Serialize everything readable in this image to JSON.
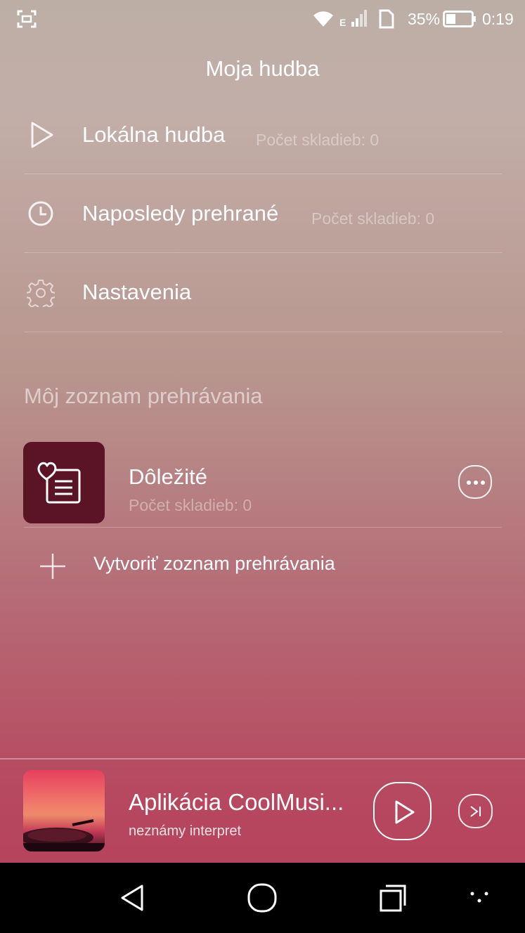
{
  "status_bar": {
    "network_type": "E",
    "battery_percent": "35%",
    "time": "0:19",
    "icons": [
      "screenshot-icon",
      "wifi-icon",
      "signal-icon",
      "sim-icon",
      "battery-icon"
    ]
  },
  "header": {
    "title": "Moja hudba"
  },
  "menu": {
    "items": [
      {
        "icon": "play-icon",
        "label": "Lokálna hudba",
        "count": "Počet skladieb: 0"
      },
      {
        "icon": "clock-icon",
        "label": "Naposledy prehrané",
        "count": "Počet skladieb: 0"
      },
      {
        "icon": "gear-icon",
        "label": "Nastavenia"
      }
    ]
  },
  "playlists": {
    "section_title": "Môj zoznam prehrávania",
    "items": [
      {
        "icon": "favorite-list-icon",
        "name": "Dôležité",
        "count": "Počet skladieb: 0"
      }
    ],
    "create_label": "Vytvoriť zoznam prehrávania"
  },
  "player": {
    "track_title": "Aplikácia CoolMusi...",
    "artist": "neznámy interpret"
  },
  "colors": {
    "playlist_thumb": "#5a1425",
    "navbar": "#000000"
  }
}
